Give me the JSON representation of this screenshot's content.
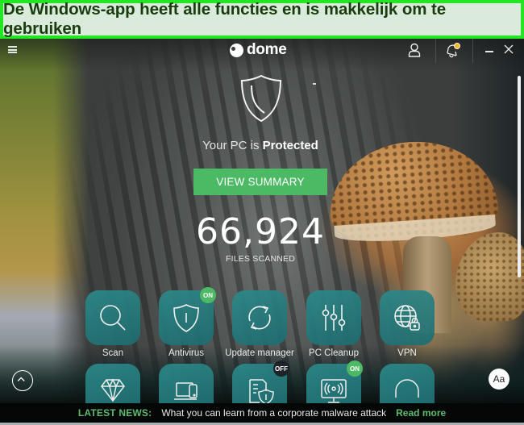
{
  "banner": {
    "text": "De Windows-app heeft alle functies en is makkelijk om te gebruiken",
    "border_color": "#21e621"
  },
  "app": {
    "logo_text": "dome",
    "notification_count_shown": true
  },
  "status": {
    "prefix": "Your PC is ",
    "state": "Protected"
  },
  "view_summary_label": "VIEW SUMMARY",
  "files_scanned": {
    "count": "66,924",
    "label": "FILES SCANNED"
  },
  "tiles_row1": [
    {
      "label": "Scan",
      "icon": "magnifier-icon"
    },
    {
      "label": "Antivirus",
      "icon": "shield-icon",
      "badge": "ON"
    },
    {
      "label": "Update manager",
      "icon": "refresh-arrows-icon"
    },
    {
      "label": "PC Cleanup",
      "icon": "sliders-icon"
    },
    {
      "label": "VPN",
      "icon": "globe-lock-icon"
    }
  ],
  "tiles_row2": [
    {
      "icon": "diamond-icon"
    },
    {
      "icon": "devices-icon"
    },
    {
      "icon": "document-shield-icon",
      "badge": "OFF"
    },
    {
      "icon": "wifi-monitor-icon",
      "badge": "ON"
    },
    {
      "icon": "headset-icon"
    }
  ],
  "font_button_label": "Aa",
  "news": {
    "label": "LATEST NEWS:",
    "headline": "What you can learn from a corporate malware attack",
    "link": "Read more"
  },
  "colors": {
    "accent_green": "#4cba64",
    "tile_teal": "#2d8a8a",
    "badge_off": "#1d2328",
    "bell_badge": "#f5b52a"
  }
}
